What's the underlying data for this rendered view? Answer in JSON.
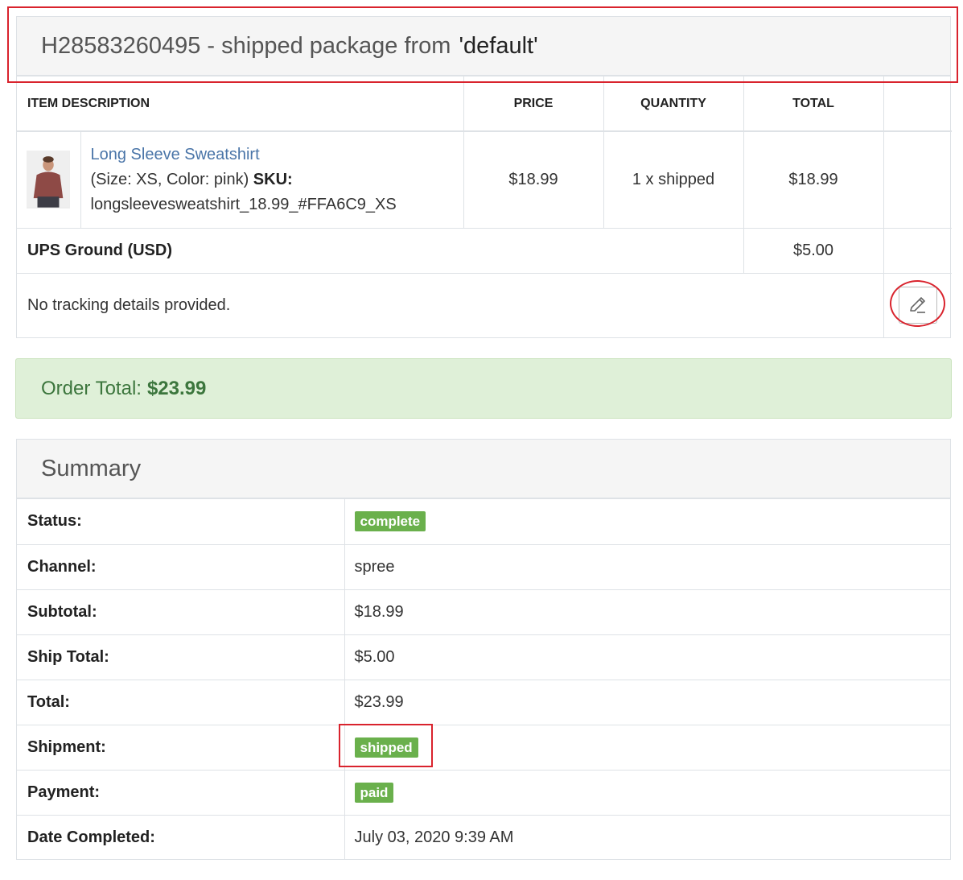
{
  "shipment": {
    "title_prefix": "H28583260495 - shipped package from",
    "title_location": "'default'",
    "columns": {
      "description": "ITEM DESCRIPTION",
      "price": "PRICE",
      "quantity": "QUANTITY",
      "total": "TOTAL"
    },
    "item": {
      "name": "Long Sleeve Sweatshirt",
      "options": "(Size: XS, Color: pink)",
      "sku_label": "SKU:",
      "sku": "longsleevesweatshirt_18.99_#FFA6C9_XS",
      "price": "$18.99",
      "quantity": "1 x shipped",
      "total": "$18.99",
      "image_icon": "product-photo-icon"
    },
    "shipping_method": "UPS Ground (USD)",
    "shipping_cost": "$5.00",
    "tracking_text": "No tracking details provided.",
    "edit_icon": "pencil-icon"
  },
  "order_total": {
    "label": "Order Total:",
    "value": "$23.99"
  },
  "summary": {
    "title": "Summary",
    "rows": [
      {
        "label": "Status:",
        "value": "complete",
        "type": "badge"
      },
      {
        "label": "Channel:",
        "value": "spree",
        "type": "text"
      },
      {
        "label": "Subtotal:",
        "value": "$18.99",
        "type": "text"
      },
      {
        "label": "Ship Total:",
        "value": "$5.00",
        "type": "text"
      },
      {
        "label": "Total:",
        "value": "$23.99",
        "type": "text"
      },
      {
        "label": "Shipment:",
        "value": "shipped",
        "type": "badge"
      },
      {
        "label": "Payment:",
        "value": "paid",
        "type": "badge"
      },
      {
        "label": "Date Completed:",
        "value": "July 03, 2020 9:39 AM",
        "type": "text"
      }
    ]
  },
  "colors": {
    "badge_green": "#6ab04c",
    "highlight_red": "#d9232d",
    "link_blue": "#4a75a8",
    "success_bg": "#dff0d8"
  }
}
